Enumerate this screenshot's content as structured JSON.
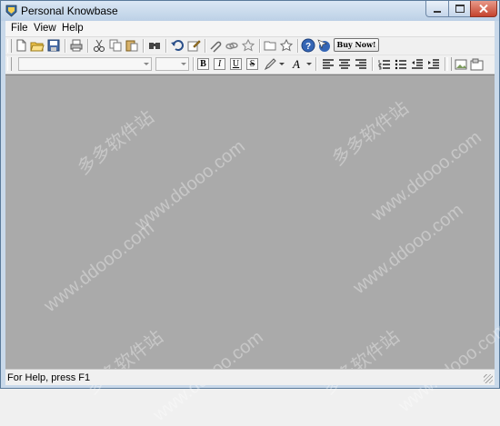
{
  "window": {
    "title": "Personal Knowbase"
  },
  "menu": [
    "File",
    "View",
    "Help"
  ],
  "toolbar1": {
    "buy_label": "Buy Now!"
  },
  "format": {
    "bold": "B",
    "italic": "I",
    "underline": "U",
    "strike": "S",
    "font_color": "A"
  },
  "watermark": [
    "多多软件站",
    "www.ddooo.com"
  ],
  "status": {
    "text": "For Help, press F1"
  },
  "colors": {
    "content_bg": "#aaaaaa",
    "titlebar": "#c9d9ea",
    "close": "#c5432d"
  }
}
